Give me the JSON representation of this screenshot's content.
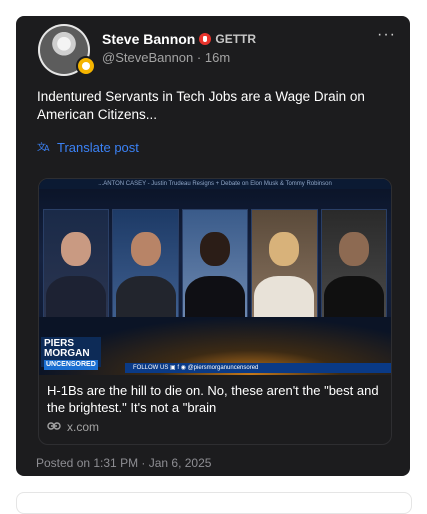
{
  "post": {
    "author_name": "Steve Bannon",
    "platform": "GETTR",
    "handle": "@SteveBannon",
    "separator": "·",
    "time": "16m",
    "more_label": "···",
    "body": "Indentured Servants in Tech Jobs  are a Wage Drain on American Citizens...",
    "translate_label": "Translate post",
    "posted_on": "Posted on 1:31 PM · Jan 6, 2025"
  },
  "embed": {
    "ticker_text": "...ANTON CASEY - Justin Trudeau Resigns + Debate on Elon Musk & Tommy Robinson",
    "show_logo_line1": "PIERS",
    "show_logo_line2": "MORGAN",
    "show_logo_line3": "UNCENSORED",
    "follow_text": "FOLLOW US  ▣  f  ◉  @piersmorganuncensored",
    "title": "H-1Bs are the hill to die on. No, these aren't the \"best and the brightest.\" It's not a \"brain",
    "link": "x.com"
  },
  "icons": {
    "badge": "verified-badge-icon",
    "gettr": "gettr-logo-icon",
    "translate": "translate-icon",
    "link": "link-icon"
  },
  "colors": {
    "card_bg": "#1c1c1e",
    "accent_blue": "#3b82f6",
    "gettr_red": "#e8342d",
    "badge_gold": "#f4b400"
  }
}
